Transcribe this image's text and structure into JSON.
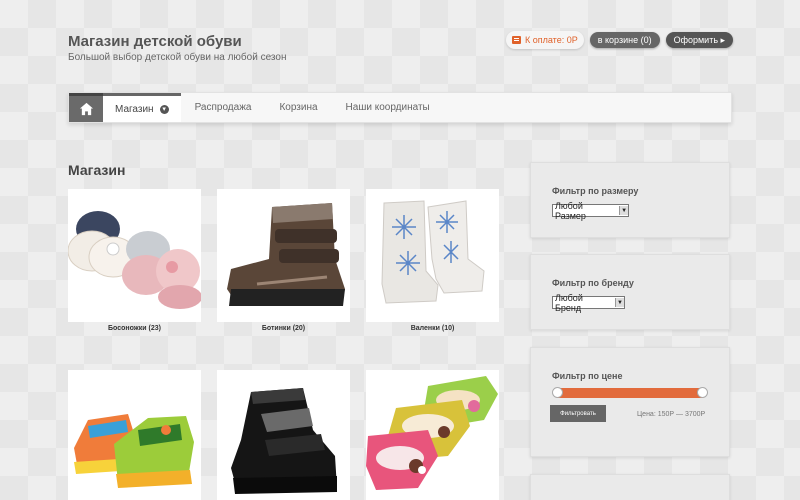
{
  "header": {
    "title": "Магазин детской обуви",
    "tagline": "Большой выбор детской обуви на любой сезон"
  },
  "cart": {
    "to_pay": "К оплате: 0Р",
    "in_cart": "в корзине (0)",
    "checkout": "Оформить ▸"
  },
  "nav": {
    "items": [
      {
        "label": "Магазин"
      },
      {
        "label": "Распродажа"
      },
      {
        "label": "Корзина"
      },
      {
        "label": "Наши координаты"
      }
    ]
  },
  "main": {
    "title": "Магазин",
    "products": [
      {
        "caption": "Босоножки (23)"
      },
      {
        "caption": "Ботинки (20)"
      },
      {
        "caption": "Валенки (10)"
      },
      {
        "caption": ""
      },
      {
        "caption": ""
      },
      {
        "caption": ""
      }
    ]
  },
  "sidebar": {
    "size_filter": {
      "title": "Фильтр по размеру",
      "selected": "Любой Размер"
    },
    "brand_filter": {
      "title": "Фильтр по бренду",
      "selected": "Любой Бренд"
    },
    "price_filter": {
      "title": "Фильтр по цене",
      "button": "Фильтровать",
      "range": "Цена: 150Р — 3700Р"
    }
  },
  "colors": {
    "accent": "#e26b3c",
    "nav_dark": "#6a6a6a"
  }
}
